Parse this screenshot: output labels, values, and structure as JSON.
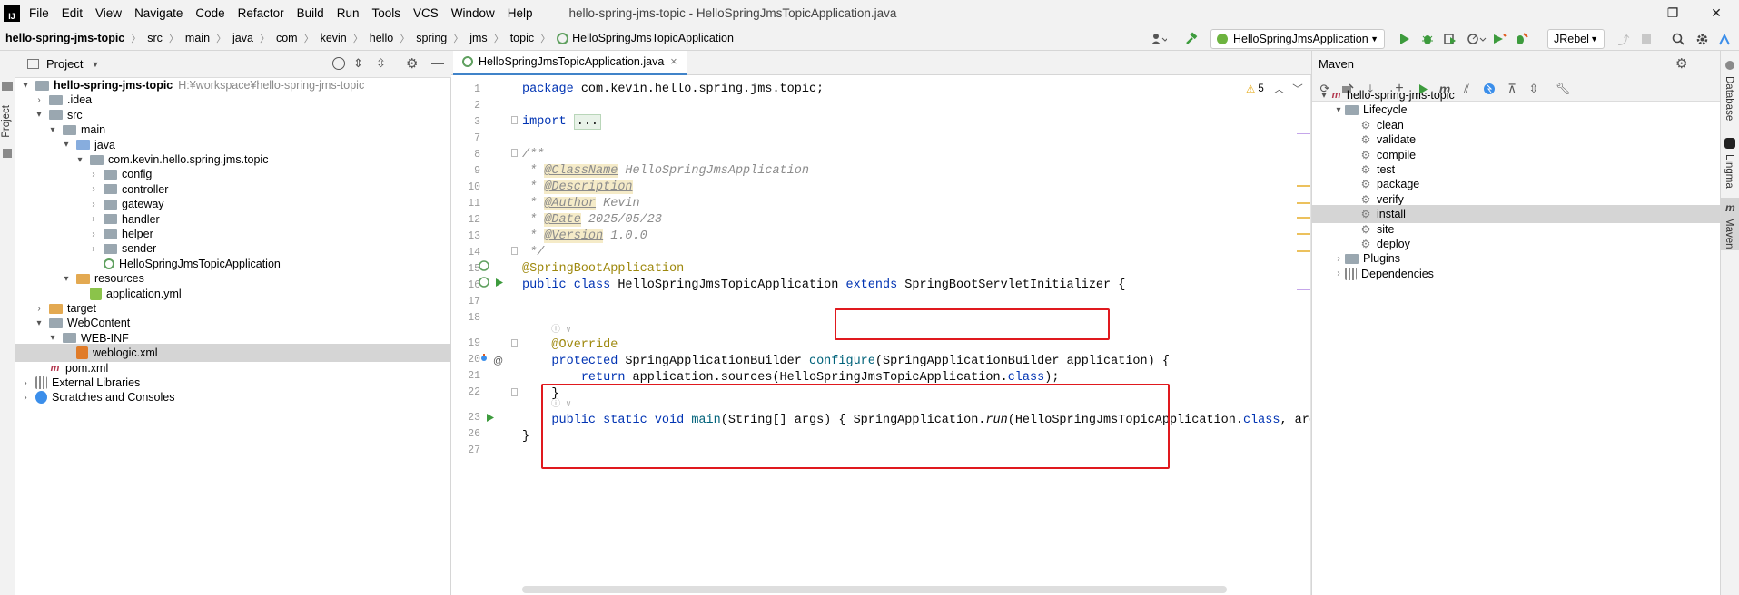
{
  "menubar": {
    "logo": "IJ",
    "items": [
      "File",
      "Edit",
      "View",
      "Navigate",
      "Code",
      "Refactor",
      "Build",
      "Run",
      "Tools",
      "VCS",
      "Window",
      "Help"
    ],
    "title": "hello-spring-jms-topic - HelloSpringJmsTopicApplication.java",
    "minimize": "—",
    "restore": "❐",
    "close": "✕"
  },
  "breadcrumb": [
    "hello-spring-jms-topic",
    "src",
    "main",
    "java",
    "com",
    "kevin",
    "hello",
    "spring",
    "jms",
    "topic",
    "HelloSpringJmsTopicApplication"
  ],
  "toolbar": {
    "user_icon": "user-icon",
    "build_icon": "hammer-icon",
    "run_config": "HelloSpringJmsApplication",
    "jrebel": "JRebel",
    "run_color": "#3d9b3d"
  },
  "left_strip": {
    "project_label": "Project"
  },
  "right_strip": {
    "database": "Database",
    "lingma": "Lingma",
    "maven": "Maven"
  },
  "project": {
    "header": "Project",
    "tree": [
      {
        "label": "hello-spring-jms-topic",
        "hint": "H:¥workspace¥hello-spring-jms-topic",
        "depth": 0,
        "arrow": "▾",
        "icon": "folder",
        "bold": true
      },
      {
        "label": ".idea",
        "depth": 1,
        "arrow": "›",
        "icon": "folder"
      },
      {
        "label": "src",
        "depth": 1,
        "arrow": "▾",
        "icon": "folder"
      },
      {
        "label": "main",
        "depth": 2,
        "arrow": "▾",
        "icon": "folder"
      },
      {
        "label": "java",
        "depth": 3,
        "arrow": "▾",
        "icon": "folder-blue"
      },
      {
        "label": "com.kevin.hello.spring.jms.topic",
        "depth": 4,
        "arrow": "▾",
        "icon": "folder"
      },
      {
        "label": "config",
        "depth": 5,
        "arrow": "›",
        "icon": "folder"
      },
      {
        "label": "controller",
        "depth": 5,
        "arrow": "›",
        "icon": "folder"
      },
      {
        "label": "gateway",
        "depth": 5,
        "arrow": "›",
        "icon": "folder"
      },
      {
        "label": "handler",
        "depth": 5,
        "arrow": "›",
        "icon": "folder"
      },
      {
        "label": "helper",
        "depth": 5,
        "arrow": "›",
        "icon": "folder"
      },
      {
        "label": "sender",
        "depth": 5,
        "arrow": "›",
        "icon": "folder"
      },
      {
        "label": "HelloSpringJmsTopicApplication",
        "depth": 5,
        "arrow": "",
        "icon": "spring-class"
      },
      {
        "label": "resources",
        "depth": 3,
        "arrow": "▾",
        "icon": "folder-orange"
      },
      {
        "label": "application.yml",
        "depth": 4,
        "arrow": "",
        "icon": "yaml"
      },
      {
        "label": "target",
        "depth": 1,
        "arrow": "›",
        "icon": "folder-orange"
      },
      {
        "label": "WebContent",
        "depth": 1,
        "arrow": "▾",
        "icon": "folder"
      },
      {
        "label": "WEB-INF",
        "depth": 2,
        "arrow": "▾",
        "icon": "folder"
      },
      {
        "label": "weblogic.xml",
        "depth": 3,
        "arrow": "",
        "icon": "xml",
        "selected": true
      },
      {
        "label": "pom.xml",
        "depth": 1,
        "arrow": "",
        "icon": "maven"
      },
      {
        "label": "External Libraries",
        "depth": 0,
        "arrow": "›",
        "icon": "libs"
      },
      {
        "label": "Scratches and Consoles",
        "depth": 0,
        "arrow": "›",
        "icon": "scratch"
      }
    ]
  },
  "editor": {
    "tab_label": "HelloSpringJmsTopicApplication.java",
    "tab_close": "×",
    "warnings": "5",
    "lines": [
      "1",
      "2",
      "3",
      "7",
      "8",
      "9",
      "10",
      "11",
      "12",
      "13",
      "14",
      "15",
      "16",
      "17",
      "18",
      "19",
      "20",
      "21",
      "22",
      "23",
      "26",
      "27"
    ],
    "code": {
      "l1_kw": "package",
      "l1_rest": " com.kevin.hello.spring.jms.topic;",
      "l3_kw": "import",
      "l3_fold": "...",
      "l8": "/**",
      "l9_star": " * ",
      "l9_tag": "@ClassName",
      "l9_val": " HelloSpringJmsApplication",
      "l10_tag": "@Description",
      "l11_tag": "@Author",
      "l11_val": " Kevin",
      "l12_tag": "@Date",
      "l12_val": " 2025/05/23",
      "l13_tag": "@Version",
      "l13_val": " 1.0.0",
      "l14": " */",
      "l15": "@SpringBootApplication",
      "l16_kw": "public class",
      "l16_name": " HelloSpringJmsTopicApplication ",
      "l16_ext": "extends",
      "l16_sup": " SpringBootServletInitializer",
      "l16_brace": " {",
      "inlay": "ⓘ ∨",
      "l19": "@Override",
      "l20_kw": "protected",
      "l20_t": " SpringApplicationBuilder ",
      "l20_fn": "configure",
      "l20_rest": "(SpringApplicationBuilder application) {",
      "l21_kw": "return",
      "l21_a": " application.sources(HelloSpringJmsTopicApplication.",
      "l21_cls": "class",
      "l21_end": ");",
      "l22": "}",
      "l23_kw": "public static void",
      "l23_fn": " main",
      "l23_a": "(String[] args) { SpringApplication.",
      "l23_run": "run",
      "l23_b": "(HelloSpringJmsTopicApplication.",
      "l23_cls": "class",
      "l23_c": ", args",
      "l26": "}"
    }
  },
  "maven": {
    "header": "Maven",
    "tree": [
      {
        "label": "hello-spring-jms-topic",
        "depth": 0,
        "arrow": "▾",
        "icon": "maven"
      },
      {
        "label": "Lifecycle",
        "depth": 1,
        "arrow": "▾",
        "icon": "folder"
      },
      {
        "label": "clean",
        "depth": 2,
        "icon": "gear"
      },
      {
        "label": "validate",
        "depth": 2,
        "icon": "gear"
      },
      {
        "label": "compile",
        "depth": 2,
        "icon": "gear"
      },
      {
        "label": "test",
        "depth": 2,
        "icon": "gear"
      },
      {
        "label": "package",
        "depth": 2,
        "icon": "gear"
      },
      {
        "label": "verify",
        "depth": 2,
        "icon": "gear"
      },
      {
        "label": "install",
        "depth": 2,
        "icon": "gear",
        "selected": true
      },
      {
        "label": "site",
        "depth": 2,
        "icon": "gear"
      },
      {
        "label": "deploy",
        "depth": 2,
        "icon": "gear"
      },
      {
        "label": "Plugins",
        "depth": 1,
        "arrow": "›",
        "icon": "folder"
      },
      {
        "label": "Dependencies",
        "depth": 1,
        "arrow": "›",
        "icon": "libs"
      }
    ]
  },
  "colors": {
    "accent": "#4083c9",
    "highlight_box": "#e0191e",
    "selection": "#d5d5d5"
  }
}
